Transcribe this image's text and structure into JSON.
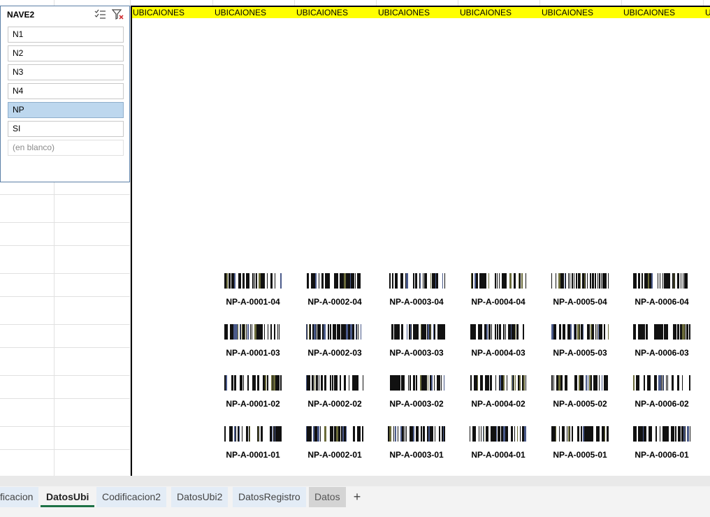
{
  "header": {
    "cells": [
      "UBICAIONES",
      "UBICAIONES",
      "UBICAIONES",
      "UBICAIONES",
      "UBICAIONES",
      "UBICAIONES",
      "UBICAIONES",
      "U"
    ]
  },
  "slicer": {
    "title": "NAVE2",
    "icons": {
      "multi_select": "multi-select-icon",
      "clear_filter": "clear-filter-icon"
    },
    "items": [
      {
        "label": "N1",
        "state": "normal"
      },
      {
        "label": "N2",
        "state": "normal"
      },
      {
        "label": "N3",
        "state": "normal"
      },
      {
        "label": "N4",
        "state": "normal"
      },
      {
        "label": "NP",
        "state": "selected"
      },
      {
        "label": "SI",
        "state": "normal"
      },
      {
        "label": "(en blanco)",
        "state": "empty"
      }
    ]
  },
  "barcodes": {
    "rows": [
      [
        "NP-A-0001-04",
        "NP-A-0002-04",
        "NP-A-0003-04",
        "NP-A-0004-04",
        "NP-A-0005-04",
        "NP-A-0006-04"
      ],
      [
        "NP-A-0001-03",
        "NP-A-0002-03",
        "NP-A-0003-03",
        "NP-A-0004-03",
        "NP-A-0005-03",
        "NP-A-0006-03"
      ],
      [
        "NP-A-0001-02",
        "NP-A-0002-02",
        "NP-A-0003-02",
        "NP-A-0004-02",
        "NP-A-0005-02",
        "NP-A-0006-02"
      ],
      [
        "NP-A-0001-01",
        "NP-A-0002-01",
        "NP-A-0003-01",
        "NP-A-0004-01",
        "NP-A-0005-01",
        "NP-A-0006-01"
      ]
    ]
  },
  "sheet_tabs": {
    "tabs": [
      {
        "label": "ficacion",
        "state": "normal"
      },
      {
        "label": "DatosUbi",
        "state": "active"
      },
      {
        "label": "Codificacion2",
        "state": "normal"
      },
      {
        "label": "DatosUbi2",
        "state": "normal"
      },
      {
        "label": "DatosRegistro",
        "state": "normal"
      },
      {
        "label": "Datos",
        "state": "dark"
      }
    ],
    "add_label": "+"
  },
  "colors": {
    "header_fill": "#ffff00",
    "slicer_selected": "#bdd7ee",
    "active_tab_underline": "#1e7145"
  }
}
